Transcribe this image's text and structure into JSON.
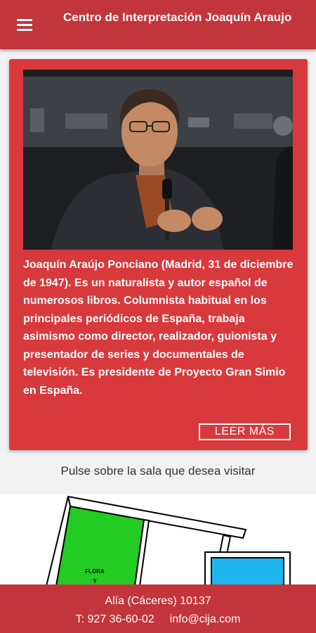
{
  "app": {
    "title": "Centro de Interpretación Joaquín Araujo",
    "menu_icon": "hamburger-menu-icon",
    "brand_color": "#c2353b",
    "card_color": "#d8393c"
  },
  "bio": {
    "text": "Joaquín Araújo Ponciano (Madrid, 31 de diciembre de 1947). Es un naturalista y autor español de numerosos libros. Columnista habitual en los principales periódicos de España, trabaja asimismo como director, realizador, guionista y presentador de series y documentales de televisión. Es presidente de Proyecto Gran Simio en España.",
    "read_more_label": "LEER MÁS"
  },
  "rooms": {
    "prompt": "Pulse sobre la sala que desea visitar",
    "flora_label": "FLORA",
    "flora_label_2": "Y",
    "flora_color": "#22cc22",
    "blue_room_color": "#1eb4ee"
  },
  "footer": {
    "address": "Alía (Cáceres)  10137",
    "phone": "T: 927 36-60-02",
    "email": "info@cija.com"
  }
}
